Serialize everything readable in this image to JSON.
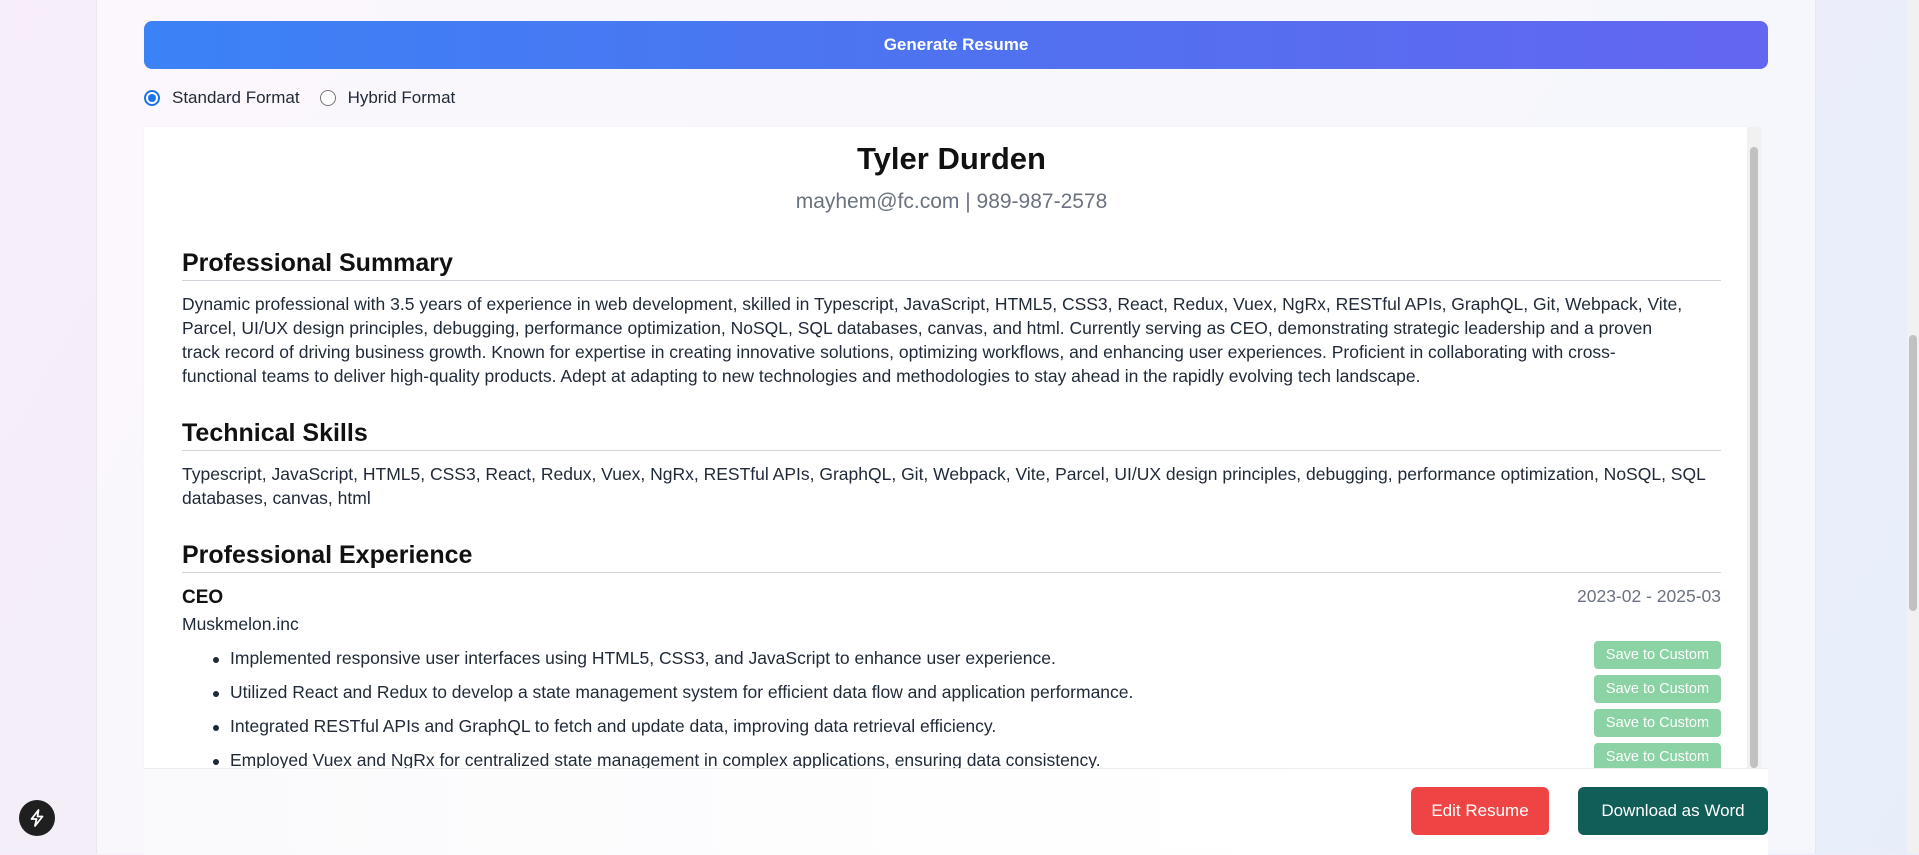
{
  "toolbar": {
    "generate_label": "Generate Resume"
  },
  "formats": {
    "standard": "Standard Format",
    "hybrid": "Hybrid Format",
    "selected": "Standard Format"
  },
  "resume": {
    "name": "Tyler Durden",
    "contact": "mayhem@fc.com | 989-987-2578",
    "summary_title": "Professional Summary",
    "summary_lines": [
      "Dynamic professional with 3.5 years of experience in web development, skilled in Typescript, JavaScript, HTML5, CSS3, React, Redux, Vuex, NgRx, RESTful APIs, GraphQL, Git, Webpack, Vite,",
      "Parcel, UI/UX design principles, debugging, performance optimization, NoSQL, SQL databases, canvas, and html. Currently serving as CEO, demonstrating strategic leadership and a proven",
      "track record of driving business growth. Known for expertise in creating innovative solutions, optimizing workflows, and enhancing user experiences. Proficient in collaborating with cross-",
      "functional teams to deliver high-quality products. Adept at adapting to new technologies and methodologies to stay ahead in the rapidly evolving tech landscape."
    ],
    "skills_title": "Technical Skills",
    "skills_lines": [
      "Typescript, JavaScript, HTML5, CSS3, React, Redux, Vuex, NgRx, RESTful APIs, GraphQL, Git, Webpack, Vite, Parcel, UI/UX design principles, debugging, performance optimization, NoSQL, SQL",
      "databases, canvas, html"
    ],
    "experience_title": "Professional Experience",
    "job": {
      "title": "CEO",
      "dates": "2023-02 - 2025-03",
      "company": "Muskmelon.inc",
      "bullets": [
        "Implemented responsive user interfaces using HTML5, CSS3, and JavaScript to enhance user experience.",
        "Utilized React and Redux to develop a state management system for efficient data flow and application performance.",
        "Integrated RESTful APIs and GraphQL to fetch and update data, improving data retrieval efficiency.",
        "Employed Vuex and NgRx for centralized state management in complex applications, ensuring data consistency."
      ],
      "save_label": "Save to Custom"
    }
  },
  "footer": {
    "edit_label": "Edit Resume",
    "download_label": "Download as Word"
  },
  "colors": {
    "generate_start": "#3b82f6",
    "generate_end": "#6366f1",
    "edit": "#ef4444",
    "download": "#115e59",
    "save": "#8bd3a5"
  },
  "icons": {
    "launcher": "lightning-bolt-icon"
  }
}
